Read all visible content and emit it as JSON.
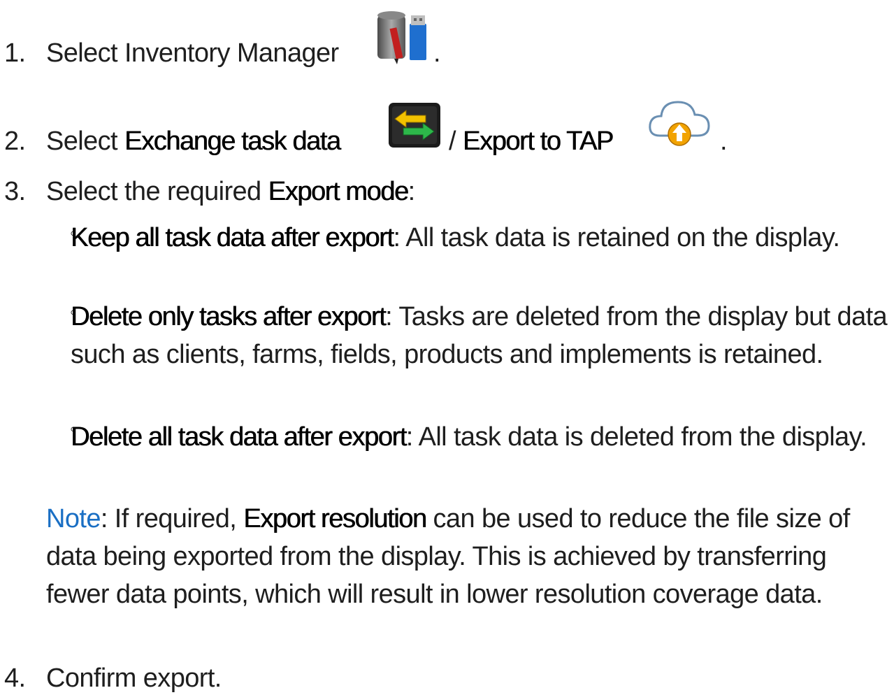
{
  "steps": [
    {
      "number": "1.",
      "text": "Select Inventory Manager",
      "suffix": ".",
      "icon": "inventory-manager-icon"
    },
    {
      "number": "2.",
      "prefix": "Select ",
      "bold1": "Exchange task data",
      "icon1": "exchange-task-data-icon",
      "sep": "/ ",
      "bold2": "Export to TAP",
      "icon2": "cloud-upload-icon",
      "suffix": "."
    },
    {
      "number": "3.",
      "prefix": "Select the required ",
      "bold": "Export mode",
      "suffix": ":"
    },
    {
      "number": "4.",
      "text": "Confirm export."
    }
  ],
  "modes": [
    {
      "bold": "Keep all task data after export",
      "text": ": All task data is retained on the display."
    },
    {
      "bold": "Delete only tasks after export",
      "text": ": Tasks are deleted from the display but data such as clients, farms, fields, products and implements is retained."
    },
    {
      "bold": "Delete all task data after export",
      "text": ": All task data is deleted from the display."
    }
  ],
  "note": {
    "label": "Note",
    "prefix": ": If required, ",
    "bold": "Export resolution",
    "text": " can be used to reduce the file size of data being exported from the display. This is achieved by transferring fewer data points, which will result in lower resolution coverage data."
  },
  "colors": {
    "note_label": "#1a6fc4",
    "text": "#1e1e1e"
  }
}
